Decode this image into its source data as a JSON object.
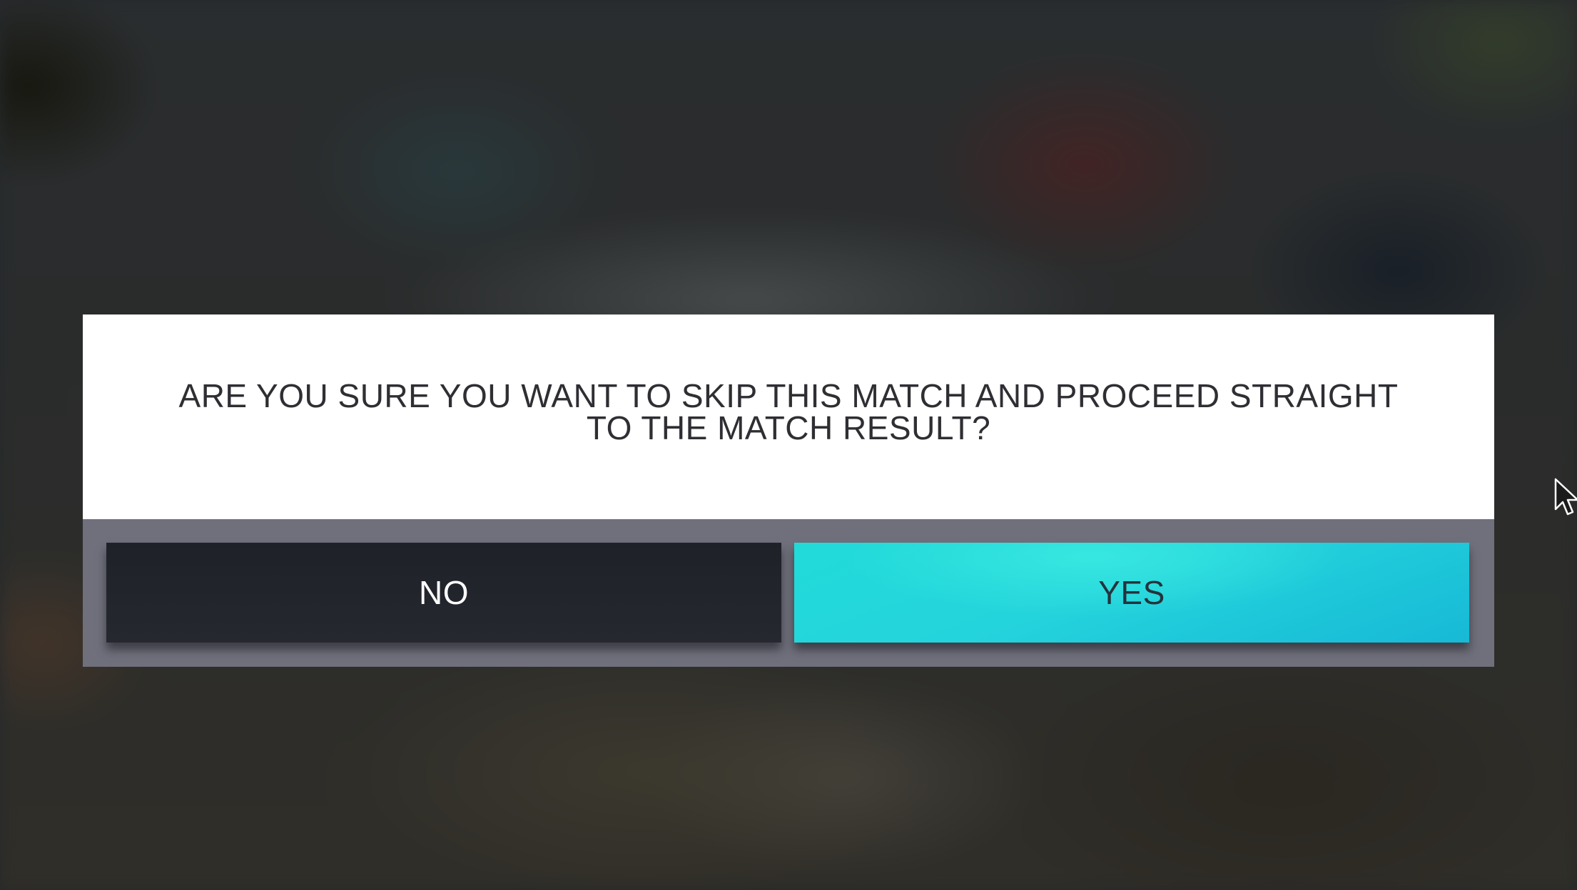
{
  "dialog": {
    "message": "ARE YOU SURE YOU WANT TO SKIP THIS MATCH AND PROCEED STRAIGHT TO THE MATCH RESULT?",
    "no_label": "NO",
    "yes_label": "YES"
  },
  "colors": {
    "panel": "#ffffff",
    "footer": "#70707c",
    "no_button": "#22242c",
    "yes_button": "#24d4dc",
    "message_text": "#2e2e33"
  },
  "icons": {
    "cursor": "mouse-pointer-icon"
  }
}
